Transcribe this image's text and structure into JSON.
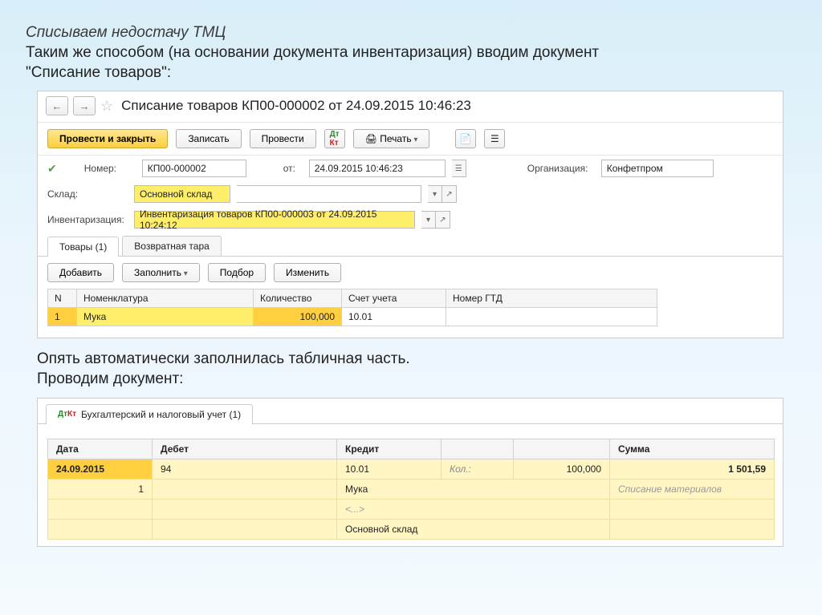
{
  "slide": {
    "title": "Списываем недостачу ТМЦ",
    "desc1": "Таким же способом (на основании документа инвентаризация) вводим документ",
    "desc2": "\"Списание товаров\":"
  },
  "doc": {
    "title": "Списание товаров КП00-000002 от 24.09.2015 10:46:23",
    "toolbar": {
      "post_close": "Провести и закрыть",
      "save": "Записать",
      "post": "Провести",
      "print": "Печать"
    },
    "form": {
      "number_label": "Номер:",
      "number": "КП00-000002",
      "date_label": "от:",
      "date": "24.09.2015 10:46:23",
      "org_label": "Организация:",
      "org": "Конфетпром",
      "sklad_label": "Склад:",
      "sklad": "Основной склад",
      "inv_label": "Инвентаризация:",
      "inv": "Инвентаризация товаров КП00-000003 от 24.09.2015 10:24:12"
    },
    "tabs": {
      "items": "Товары (1)",
      "tara": "Возвратная тара"
    },
    "tab_toolbar": {
      "add": "Добавить",
      "fill": "Заполнить",
      "podbor": "Подбор",
      "change": "Изменить"
    },
    "table": {
      "cols": {
        "n": "N",
        "nom": "Номенклатура",
        "qty": "Количество",
        "account": "Счет учета",
        "gtd": "Номер ГТД"
      },
      "rows": [
        {
          "n": "1",
          "nom": "Мука",
          "qty": "100,000",
          "account": "10.01",
          "gtd": ""
        }
      ]
    }
  },
  "comment": {
    "line1": "Опять автоматически заполнилась табличная часть.",
    "line2": "Проводим документ:"
  },
  "posting": {
    "tab_label": "Бухгалтерский и налоговый учет (1)",
    "cols": {
      "date": "Дата",
      "debet": "Дебет",
      "kredit": "Кредит",
      "sum": "Сумма"
    },
    "row": {
      "date": "24.09.2015",
      "n": "1",
      "debet": "94",
      "kredit_acc": "10.01",
      "kol_label": "Кол.:",
      "kol": "100,000",
      "sum": "1 501,59",
      "kredit_sub1": "Мука",
      "op": "Списание материалов",
      "kredit_sub2": "<...>",
      "kredit_sub3": "Основной склад"
    }
  }
}
